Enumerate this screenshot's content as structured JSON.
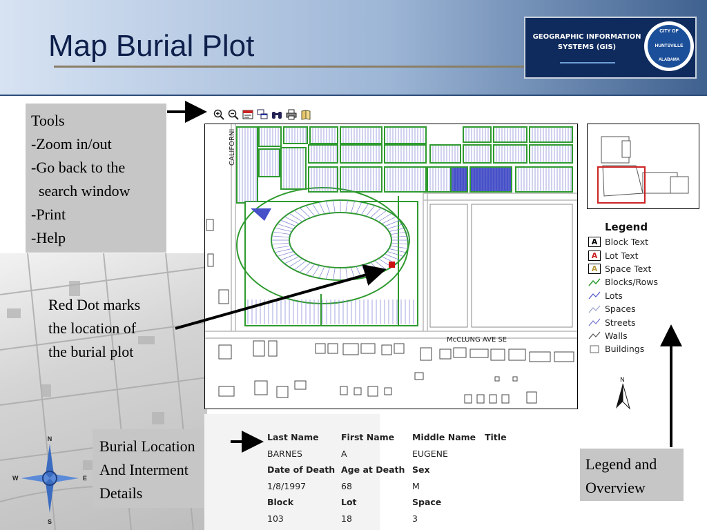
{
  "header": {
    "title": "Map Burial Plot",
    "logo": {
      "gis_line1": "GEOGRAPHIC INFORMATION",
      "gis_line2": "SYSTEMS (GIS)",
      "seal_city": "CITY OF",
      "seal_name": "HUNTSVILLE",
      "seal_state": "ALABAMA"
    }
  },
  "notes": {
    "tools": [
      "Tools",
      "-Zoom in/out",
      "-Go back to the",
      "  search window",
      "-Print",
      "-Help"
    ],
    "red_dot": [
      "Red Dot marks",
      "the location of",
      "the burial plot"
    ],
    "burial": [
      "Burial Location",
      "And Interment",
      "Details"
    ],
    "legend_overview": [
      "Legend and",
      "Overview"
    ]
  },
  "toolbar": {
    "icons": [
      "zoom-in-icon",
      "zoom-out-icon",
      "back-to-search-icon",
      "identify-icon",
      "find-icon",
      "print-icon",
      "help-icon"
    ]
  },
  "map": {
    "street_california": "CALIFORNI",
    "street_mcclung": "McCLUNG AVE SE",
    "plot_marker_color": "#cc1111"
  },
  "legend": {
    "title": "Legend",
    "items": [
      {
        "label": "Block Text",
        "symbol": "A",
        "color": "#000000"
      },
      {
        "label": "Lot Text",
        "symbol": "A",
        "color": "#cc2222"
      },
      {
        "label": "Space Text",
        "symbol": "A",
        "color": "#b89a3a"
      },
      {
        "label": "Blocks/Rows",
        "color": "#2e9a2e"
      },
      {
        "label": "Lots",
        "color": "#4b52c7"
      },
      {
        "label": "Spaces",
        "color": "#9aa0cc"
      },
      {
        "label": "Streets",
        "color": "#6f74c8"
      },
      {
        "label": "Walls",
        "color": "#555555"
      },
      {
        "label": "Buildings",
        "color": "#666666"
      }
    ],
    "north_label": "N"
  },
  "details": {
    "rows": [
      [
        "Last Name",
        "First Name",
        "Middle Name",
        "Title"
      ],
      [
        "BARNES",
        "A",
        "EUGENE",
        ""
      ],
      [
        "Date of Death",
        "Age at Death",
        "Sex",
        ""
      ],
      [
        "1/8/1997",
        "68",
        "M",
        ""
      ],
      [
        "Block",
        "Lot",
        "Space",
        ""
      ],
      [
        "103",
        "18",
        "3",
        ""
      ]
    ]
  },
  "compass": {
    "n": "N",
    "s": "S",
    "e": "E",
    "w": "W"
  }
}
